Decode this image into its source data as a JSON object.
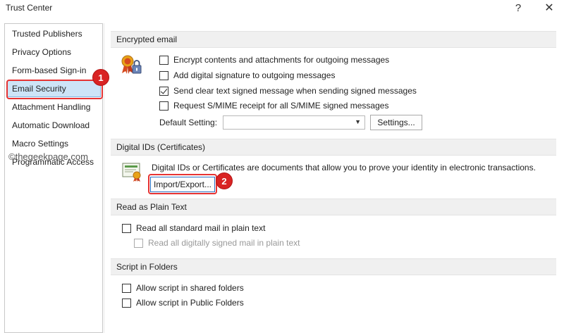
{
  "window": {
    "title": "Trust Center",
    "help": "?",
    "close": "✕"
  },
  "sidebar": {
    "items": [
      {
        "label": "Trusted Publishers"
      },
      {
        "label": "Privacy Options"
      },
      {
        "label": "Form-based Sign-in"
      },
      {
        "label": "Email Security",
        "selected": true
      },
      {
        "label": "Attachment Handling"
      },
      {
        "label": "Automatic Download"
      },
      {
        "label": "Macro Settings"
      },
      {
        "label": "Programmatic Access"
      }
    ]
  },
  "watermark": "©thegeekpage.com",
  "badges": [
    "1",
    "2"
  ],
  "encrypted_email": {
    "header": "Encrypted email",
    "options": [
      {
        "label": "Encrypt contents and attachments for outgoing messages",
        "checked": false
      },
      {
        "label": "Add digital signature to outgoing messages",
        "checked": false
      },
      {
        "label": "Send clear text signed message when sending signed messages",
        "checked": true
      },
      {
        "label": "Request S/MIME receipt for all S/MIME signed messages",
        "checked": false
      }
    ],
    "default_setting_label": "Default Setting:",
    "default_setting_value": "",
    "settings_button": "Settings..."
  },
  "digital_ids": {
    "header": "Digital IDs (Certificates)",
    "description": "Digital IDs or Certificates are documents that allow you to prove your identity in electronic transactions.",
    "import_export_button": "Import/Export..."
  },
  "plain_text": {
    "header": "Read as Plain Text",
    "options": [
      {
        "label": "Read all standard mail in plain text",
        "checked": false,
        "disabled": false
      },
      {
        "label": "Read all digitally signed mail in plain text",
        "checked": false,
        "disabled": true
      }
    ]
  },
  "script_folders": {
    "header": "Script in Folders",
    "options": [
      {
        "label": "Allow script in shared folders",
        "checked": false
      },
      {
        "label": "Allow script in Public Folders",
        "checked": false
      }
    ]
  },
  "colors": {
    "selection_fill": "#cde4f7",
    "highlight_red": "#e63333",
    "badge_red": "#d92323",
    "section_bg": "#f0f0f0"
  }
}
